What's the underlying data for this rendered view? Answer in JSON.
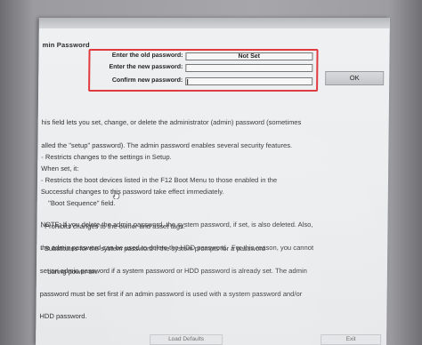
{
  "window": {
    "section_title": "min Password"
  },
  "password_form": {
    "old_label": "Enter the old password:",
    "old_status": "Not Set",
    "new_label": "Enter the new password:",
    "confirm_label": "Confirm new password:",
    "highlight_color": "#e0393e"
  },
  "buttons": {
    "ok": "OK",
    "load_defaults": "Load Defaults",
    "exit": "Exit"
  },
  "help": {
    "intro": [
      "his field lets you set, change, or delete the administrator (admin) password (sometimes",
      "alled the \"setup\" password). The admin password enables several security features.",
      "When set, it:"
    ],
    "bullets": [
      "- Restricts changes to the settings in Setup.",
      "- Restricts the boot devices listed in the F12 Boot Menu to those enabled in the",
      "    \"Boot Sequence\" field.",
      "- Prohibits changes to the owner and asset tags.",
      "- Substitutes for the system password if the system prompts for a password",
      "    during power on."
    ],
    "success": "Successful changes to this password take effect immediately.",
    "note": [
      "NOTE: If you delete the admin password, the system password, if set, is also deleted. Also,",
      "the admin password can be used to delete the HDD password.  For this reason, you cannot",
      "set an admin password if a system password or HDD password is already set. The admin",
      "password must be set first if an admin password is used with a system password and/or",
      "HDD password."
    ]
  },
  "icons": {
    "mouse_cursor": "pointer-hand-icon"
  }
}
